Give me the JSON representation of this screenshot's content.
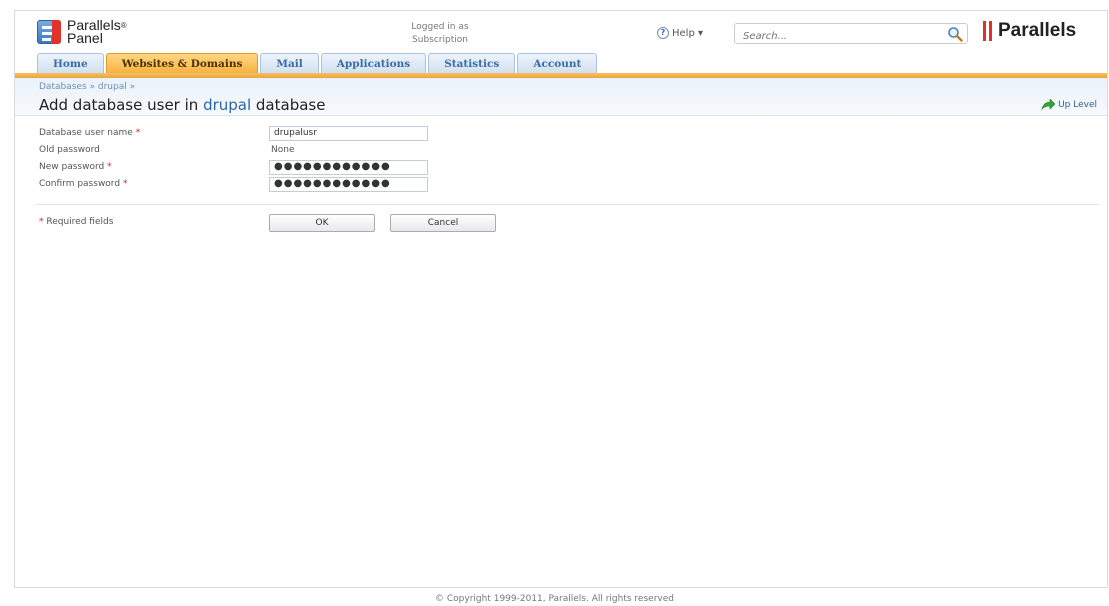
{
  "header": {
    "brand_line1": "Parallels",
    "brand_sup": "®",
    "brand_line2": "Panel",
    "logged_in": "Logged in as",
    "subscription": "Subscription",
    "help_label": "Help ▾",
    "search_placeholder": "Search...",
    "parallels_logo": "Parallels"
  },
  "tabs": [
    {
      "label": "Home"
    },
    {
      "label": "Websites & Domains",
      "active": true
    },
    {
      "label": "Mail"
    },
    {
      "label": "Applications"
    },
    {
      "label": "Statistics"
    },
    {
      "label": "Account"
    }
  ],
  "breadcrumb": "Databases » drupal »",
  "page_title": {
    "prefix": "Add database user in ",
    "highlight": "drupal",
    "suffix": " database"
  },
  "up_level": "Up Level",
  "form": {
    "user_name_label": "Database user name",
    "user_name_value": "drupalusr",
    "old_password_label": "Old password",
    "old_password_value": "None",
    "new_password_label": "New password",
    "new_password_value": "●●●●●●●●●●●●",
    "confirm_password_label": "Confirm password",
    "confirm_password_value": "●●●●●●●●●●●●",
    "required_mark": "*",
    "required_note": "Required fields",
    "ok_label": "OK",
    "cancel_label": "Cancel"
  },
  "footer": "© Copyright 1999-2011, Parallels. All rights reserved",
  "colors": {
    "active_tab": "#f6b13d",
    "tab_text": "#3a6da6",
    "title_highlight": "#2c64b0",
    "required": "#d02020"
  }
}
